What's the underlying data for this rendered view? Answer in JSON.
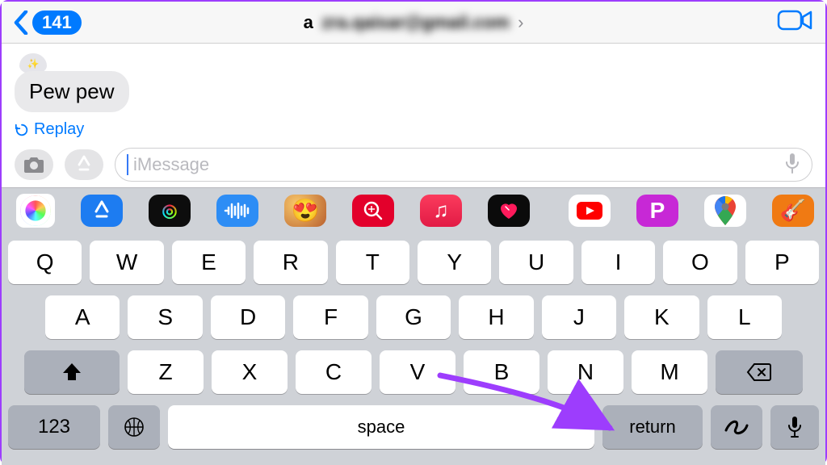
{
  "nav": {
    "back_count": "141",
    "title_visible_prefix": "a",
    "title_blurred": "zra.qaisar@gmail.com"
  },
  "conversation": {
    "last_message": "Pew pew",
    "replay_label": "Replay"
  },
  "composer": {
    "placeholder": "iMessage"
  },
  "apps": [
    {
      "name": "photos"
    },
    {
      "name": "appstore"
    },
    {
      "name": "fitness"
    },
    {
      "name": "audio-messages"
    },
    {
      "name": "memoji"
    },
    {
      "name": "findmy"
    },
    {
      "name": "music"
    },
    {
      "name": "digital-touch"
    },
    {
      "name": "youtube"
    },
    {
      "name": "picsart"
    },
    {
      "name": "google-maps"
    },
    {
      "name": "garageband"
    }
  ],
  "keyboard": {
    "row1": [
      "Q",
      "W",
      "E",
      "R",
      "T",
      "Y",
      "U",
      "I",
      "O",
      "P"
    ],
    "row2": [
      "A",
      "S",
      "D",
      "F",
      "G",
      "H",
      "J",
      "K",
      "L"
    ],
    "row3": [
      "Z",
      "X",
      "C",
      "V",
      "B",
      "N",
      "M"
    ],
    "numbers_label": "123",
    "space_label": "space",
    "return_label": "return"
  }
}
